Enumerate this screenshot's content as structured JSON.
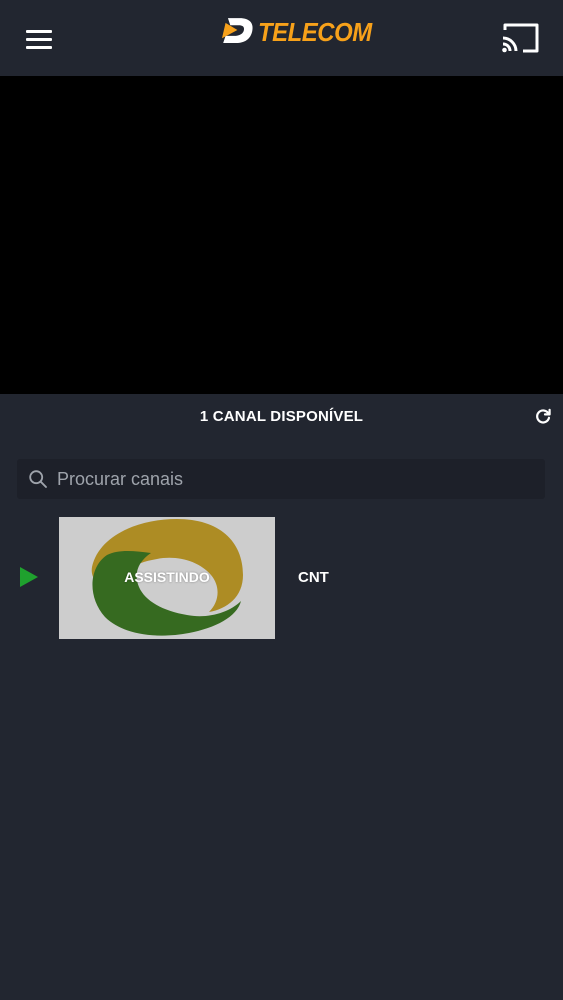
{
  "header": {
    "logo_text": "TELECOM",
    "menu_icon": "hamburger-menu-icon",
    "cast_icon": "cast-icon",
    "brand_color": "#f7a11a"
  },
  "channels": {
    "count_label": "1 CANAL DISPONÍVEL",
    "refresh_icon": "refresh-icon",
    "search": {
      "placeholder": "Procurar canais",
      "value": ""
    },
    "items": [
      {
        "name": "CNT",
        "status_label": "ASSISTINDO",
        "playing": true,
        "indicator_color": "#1fa12e"
      }
    ]
  },
  "colors": {
    "background": "#222630",
    "player": "#000000"
  }
}
